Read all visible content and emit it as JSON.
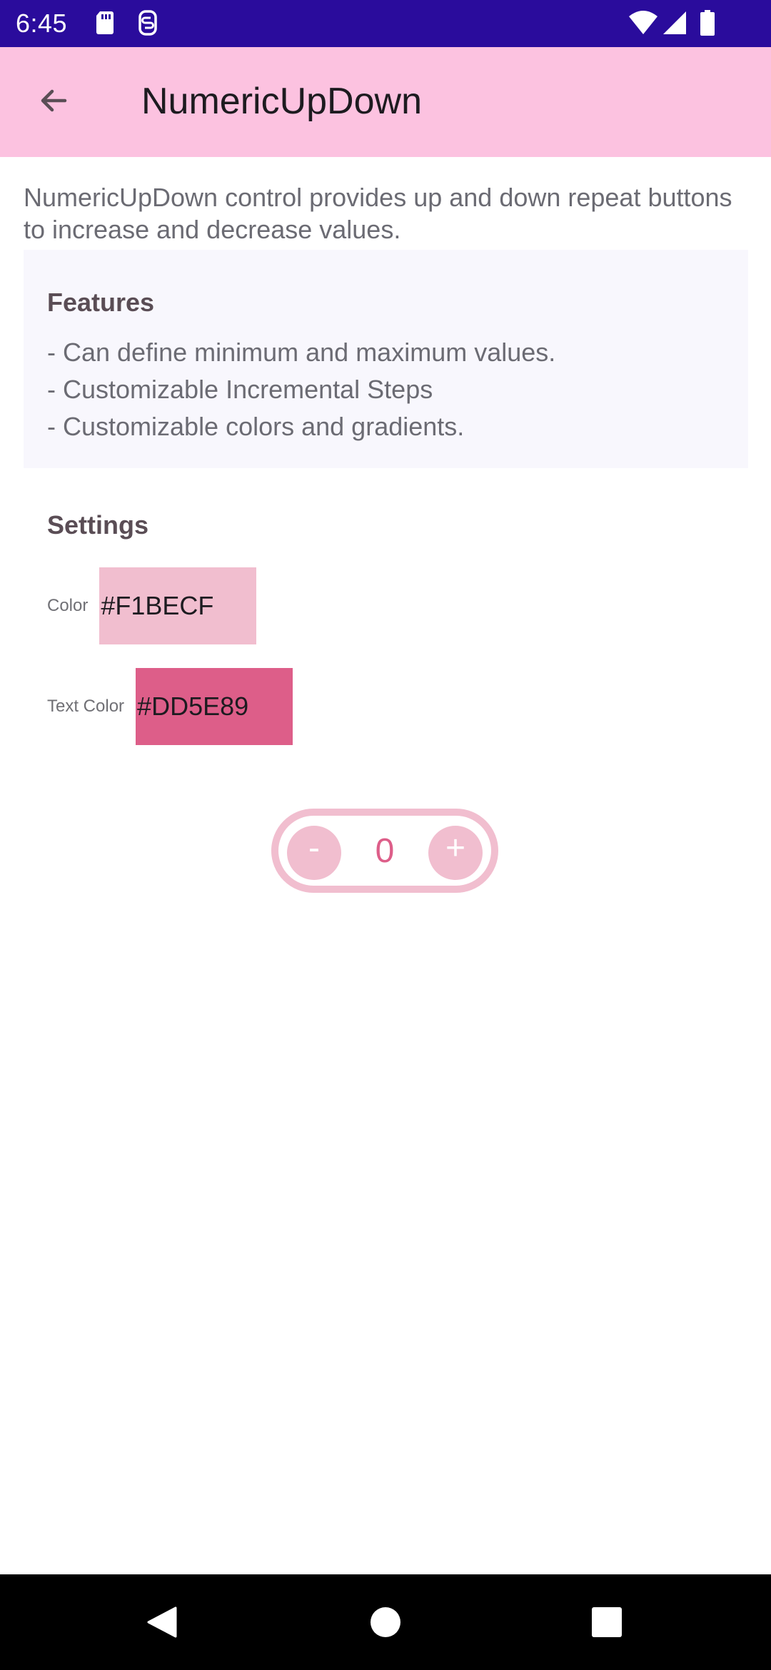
{
  "status_bar": {
    "time": "6:45",
    "icons": [
      "sd-card-icon",
      "sync-icon",
      "wifi-icon",
      "signal-icon",
      "battery-icon"
    ]
  },
  "app_bar": {
    "back_icon": "arrow-left-icon",
    "title": "NumericUpDown"
  },
  "description": "NumericUpDown control provides up and down repeat buttons to increase and decrease values.",
  "features": {
    "heading": "Features",
    "items": [
      "- Can define minimum and maximum values.",
      "- Customizable Incremental Steps",
      "- Customizable colors and gradients."
    ]
  },
  "settings": {
    "heading": "Settings",
    "color": {
      "label": "Color",
      "value": "#F1BECF"
    },
    "text_color": {
      "label": "Text Color",
      "value": "#DD5E89"
    }
  },
  "stepper": {
    "minus_label": "-",
    "plus_label": "+",
    "value": "0",
    "color": "#F1BECF",
    "text_color": "#DD5E89"
  },
  "nav_bar": {
    "icons": [
      "back-triangle-icon",
      "home-circle-icon",
      "recents-square-icon"
    ]
  },
  "colors": {
    "status_bar": "#2A0C9C",
    "app_bar": "#FCC2E0",
    "features_panel": "#F8F7FD"
  }
}
